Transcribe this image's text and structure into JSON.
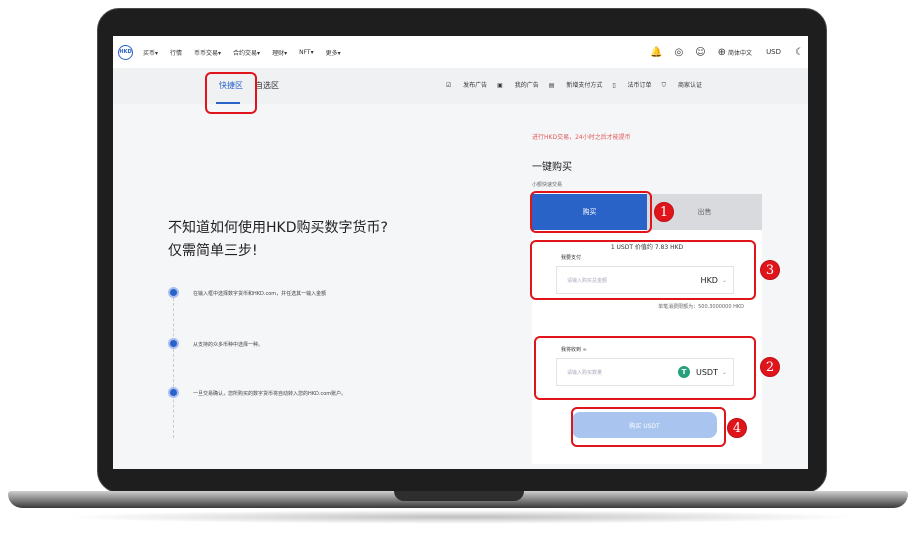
{
  "nav": {
    "logo_text": "HKD",
    "items": [
      "买币▾",
      "行情",
      "币币交易▾",
      "合约交易▾",
      "理财▾",
      "NFT▾",
      "更多▾"
    ],
    "language": "简体中文",
    "currency": "USD"
  },
  "subnav": {
    "tab_quick": "快捷区",
    "tab_fav": "自选区",
    "actions": [
      "发布广告",
      "我的广告",
      "新增支付方式",
      "法币订单",
      "商家认证"
    ]
  },
  "hero": {
    "line1": "不知道如何使用HKD购买数字货币?",
    "line2": "仅需简单三步!"
  },
  "steps": [
    "在输入框中选择数字货币和HKD.com，并任选其一输入金额",
    "从支持的众多币种中选择一种。",
    "一旦交易确认，您所购买的数字货币将自动转入您的HKD.com账户。"
  ],
  "panel": {
    "notice": "进行HKD交易，24小时之后才能提币",
    "title": "一键购买",
    "subtitle": "小额快速交易",
    "buy_tab": "购买",
    "sell_tab": "出售",
    "rate": "1 USDT 价值约 7.83 HKD",
    "pay_label": "我要支付",
    "pay_placeholder": "请输入购买总金额",
    "pay_currency": "HKD",
    "limit": "单笔消费限额为：500.3000000 HKD",
    "receive_label": "我将收到 ≈",
    "receive_placeholder": "请输入购买数量",
    "receive_currency": "USDT",
    "buy_button": "购买 USDT"
  },
  "annotations": [
    "1",
    "2",
    "3",
    "4"
  ],
  "colors": {
    "primary": "#2a63c7",
    "annotation": "#e0141b",
    "notice": "#e05a5a",
    "tether": "#26a17b"
  }
}
